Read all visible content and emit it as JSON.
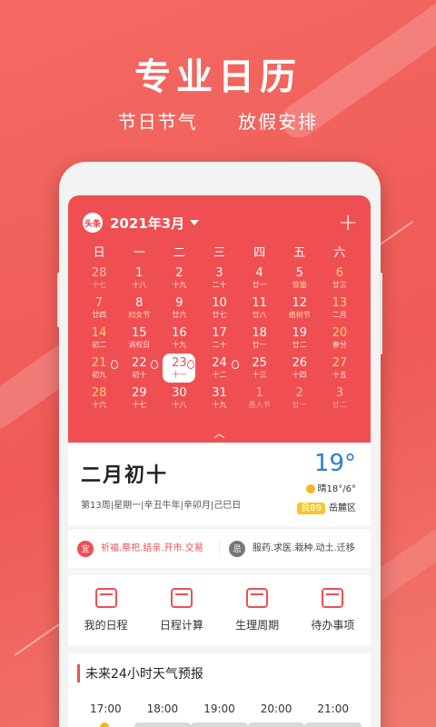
{
  "hero": {
    "title": "专业日历",
    "sub1": "节日节气",
    "sub2": "放假安排"
  },
  "calendar": {
    "logo": "头条",
    "month": "2021年3月",
    "weekdays": [
      "日",
      "一",
      "二",
      "三",
      "四",
      "五",
      "六"
    ],
    "cells": [
      {
        "d": "28",
        "l": "十七",
        "dim": true
      },
      {
        "d": "1",
        "l": "十八"
      },
      {
        "d": "2",
        "l": "十九"
      },
      {
        "d": "3",
        "l": "二十"
      },
      {
        "d": "4",
        "l": "廿一"
      },
      {
        "d": "5",
        "l": "惊蛰",
        "hol": true
      },
      {
        "d": "6",
        "l": "廿三",
        "wk": true
      },
      {
        "d": "7",
        "l": "廿四",
        "wk": true
      },
      {
        "d": "8",
        "l": "妇女节",
        "hol": true
      },
      {
        "d": "9",
        "l": "廿六"
      },
      {
        "d": "10",
        "l": "廿七"
      },
      {
        "d": "11",
        "l": "廿八"
      },
      {
        "d": "12",
        "l": "植树节",
        "hol": true
      },
      {
        "d": "13",
        "l": "二月",
        "wk": true
      },
      {
        "d": "14",
        "l": "初二",
        "wk": true
      },
      {
        "d": "15",
        "l": "消权日"
      },
      {
        "d": "16",
        "l": "十九"
      },
      {
        "d": "17",
        "l": "二十"
      },
      {
        "d": "18",
        "l": "廿一"
      },
      {
        "d": "19",
        "l": "廿二"
      },
      {
        "d": "20",
        "l": "春分",
        "wk": true
      },
      {
        "d": "21",
        "l": "初九",
        "wk": true
      },
      {
        "d": "22",
        "l": "初十"
      },
      {
        "d": "23",
        "l": "十一",
        "today": true
      },
      {
        "d": "24",
        "l": "十二"
      },
      {
        "d": "25",
        "l": "十三"
      },
      {
        "d": "26",
        "l": "十四"
      },
      {
        "d": "27",
        "l": "十五",
        "wk": true
      },
      {
        "d": "28",
        "l": "十六",
        "wk": true
      },
      {
        "d": "29",
        "l": "十七"
      },
      {
        "d": "30",
        "l": "十八"
      },
      {
        "d": "31",
        "l": "十九"
      },
      {
        "d": "1",
        "l": "愚人节",
        "dim": true
      },
      {
        "d": "2",
        "l": "廿一",
        "dim": true
      },
      {
        "d": "3",
        "l": "廿二",
        "dim": true
      }
    ]
  },
  "today": {
    "lunar": "二月初十",
    "detail": "第13周|星期一|辛丑牛年|辛卯月|己巳日",
    "temp": "19°",
    "weather": "晴18°/6°",
    "aqi_badge": "良89",
    "district": "岳麓区"
  },
  "yiji": {
    "yi_label": "宜",
    "yi_text": "祈福.祭祀.结亲.开市.交易",
    "ji_label": "忌",
    "ji_text": "服药.求医.栽种.动土.迁移"
  },
  "tools": [
    "我的日程",
    "日程计算",
    "生理周期",
    "待办事项"
  ],
  "forecast": {
    "title": "未来24小时天气预报",
    "hours": [
      "17:00",
      "18:00",
      "19:00",
      "20:00",
      "21:00"
    ]
  }
}
